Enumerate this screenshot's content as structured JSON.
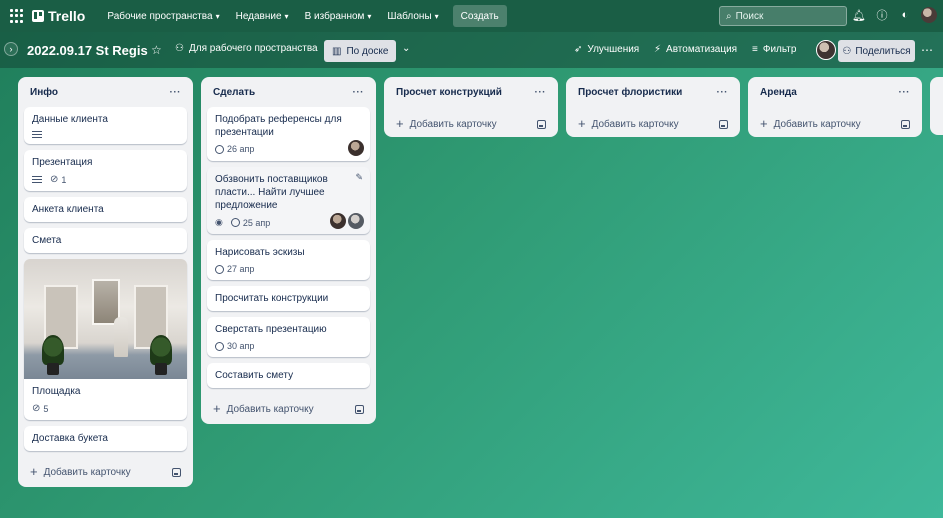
{
  "topbar": {
    "app_name": "Trello",
    "menus": [
      {
        "label": "Рабочие пространства"
      },
      {
        "label": "Недавние"
      },
      {
        "label": "В избранном"
      },
      {
        "label": "Шаблоны"
      }
    ],
    "create_label": "Создать",
    "search_placeholder": "Поиск",
    "icons": [
      "bell-icon",
      "help-icon",
      "theme-icon",
      "avatar"
    ]
  },
  "board": {
    "title": "2022.09.17 St Regis",
    "visibility_label": "Для рабочего пространства",
    "view_label": "По доске",
    "improvements_label": "Улучшения",
    "automation_label": "Автоматизация",
    "filter_label": "Фильтр",
    "share_label": "Поделиться"
  },
  "lists": [
    {
      "title": "Инфо",
      "cards": [
        {
          "title": "Данные клиента",
          "has_description": true
        },
        {
          "title": "Презентация",
          "has_description": true,
          "attachments": "1"
        },
        {
          "title": "Анкета клиента"
        },
        {
          "title": "Смета"
        },
        {
          "title": "Площадка",
          "has_cover": true,
          "attachments": "5"
        },
        {
          "title": "Доставка букета"
        }
      ],
      "add_label": "Добавить карточку"
    },
    {
      "title": "Сделать",
      "cards": [
        {
          "title": "Подобрать референсы для презентации",
          "due": "26 апр",
          "members": 1
        },
        {
          "title": "Обзвонить поставщиков пласти... Найти лучшее предложение",
          "watching": true,
          "due": "25 апр",
          "members": 2
        },
        {
          "title": "Нарисовать эскизы",
          "due": "27 апр"
        },
        {
          "title": "Просчитать конструкции"
        },
        {
          "title": "Сверстать презентацию",
          "due": "30 апр"
        },
        {
          "title": "Составить смету"
        }
      ],
      "add_label": "Добавить карточку"
    },
    {
      "title": "Просчет конструкций",
      "cards": [],
      "add_label": "Добавить карточку"
    },
    {
      "title": "Просчет флористики",
      "cards": [],
      "add_label": "Добавить карточку"
    },
    {
      "title": "Аренда",
      "cards": [],
      "add_label": "Добавить карточку"
    }
  ],
  "colors": {
    "topbar_bg": "#1a5e45",
    "board_gradient_start": "#1f7d5a",
    "board_gradient_end": "#3fb89a",
    "list_bg": "#f1f2f4"
  }
}
